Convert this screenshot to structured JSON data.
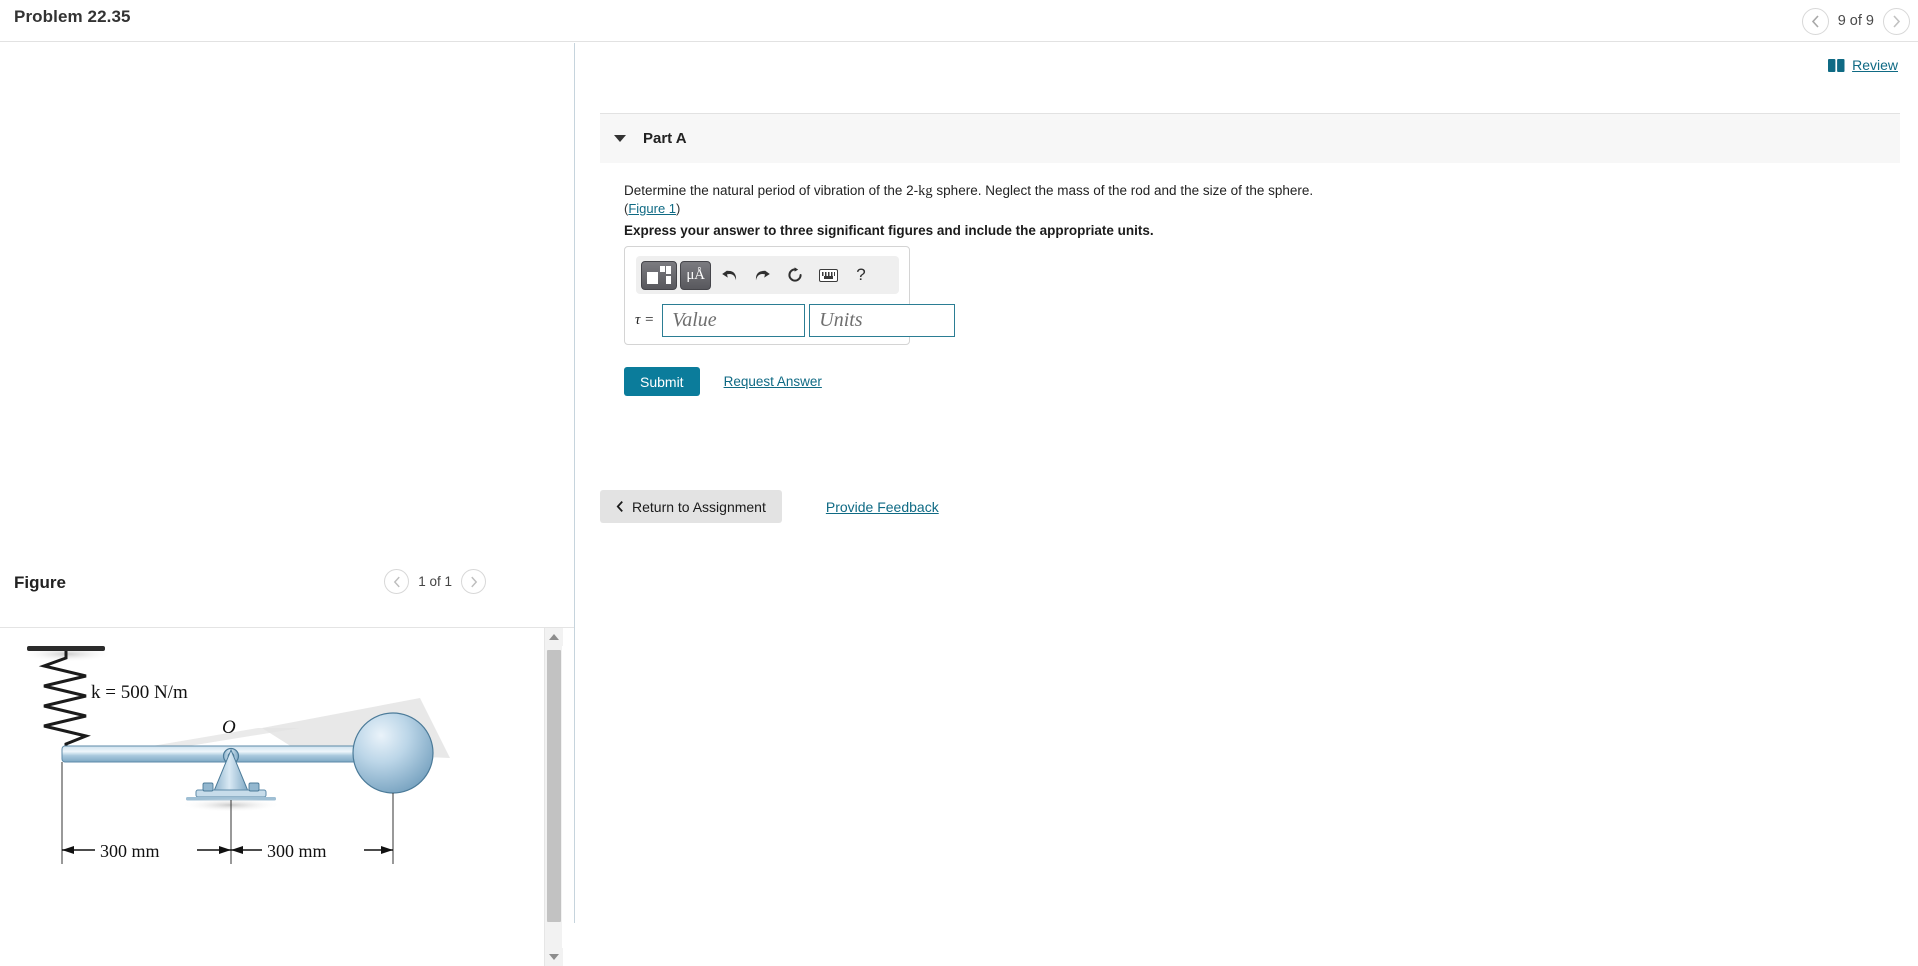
{
  "topbar": {
    "problem_title": "Problem 22.35",
    "pager_label": "9 of 9",
    "prev_icon": "chevron-left-icon",
    "next_icon": "chevron-right-icon"
  },
  "review": {
    "label": "Review",
    "icon": "book-icon",
    "color": "#0f6a84"
  },
  "part": {
    "label": "Part A",
    "caret_icon": "caret-down-icon",
    "prompt": "Determine the natural period of vibration of the 2-kg sphere. Neglect the mass of the rod and the size of the sphere.",
    "prompt_lead": "Determine the natural period of vibration of the 2-",
    "prompt_kg": "kg",
    "prompt_tail": " sphere. Neglect the mass of the rod and the size of the sphere.",
    "figure_ref_open": "(",
    "figure_ref": "Figure 1",
    "figure_ref_close": ")",
    "instruction": "Express your answer to three significant figures and include the appropriate units."
  },
  "answer": {
    "variable": "τ =",
    "value_placeholder": "Value",
    "units_placeholder": "Units",
    "value": "",
    "units": "",
    "toolbar": [
      {
        "name": "template-icon",
        "label": ""
      },
      {
        "name": "units-micro-angstrom-icon",
        "label": "μÅ"
      },
      {
        "name": "undo-icon",
        "label": "↩"
      },
      {
        "name": "redo-icon",
        "label": "↪"
      },
      {
        "name": "reset-icon",
        "label": "↻"
      },
      {
        "name": "keyboard-icon",
        "label": ""
      },
      {
        "name": "help-icon",
        "label": "?"
      }
    ],
    "submit_label": "Submit",
    "request_answer_label": "Request Answer",
    "accent_color": "#0b7c9b",
    "input_border_color": "#2b7d94"
  },
  "footer": {
    "return_label": "Return to Assignment",
    "return_icon": "chevron-left-icon",
    "feedback_label": "Provide Feedback"
  },
  "figure_panel": {
    "title": "Figure",
    "pager_label": "1 of 1",
    "prev_icon": "chevron-left-icon",
    "next_icon": "chevron-right-icon",
    "scrollbar": {
      "up_icon": "scroll-up-arrow-icon",
      "down_icon": "scroll-down-arrow-icon"
    }
  },
  "diagram": {
    "spring_label": "k = 500 N/m",
    "pivot_label": "O",
    "dim_left": "300 mm",
    "dim_right": "300 mm",
    "rod_color": "#a9c9dd",
    "sphere_color": "#b4cfe2"
  }
}
